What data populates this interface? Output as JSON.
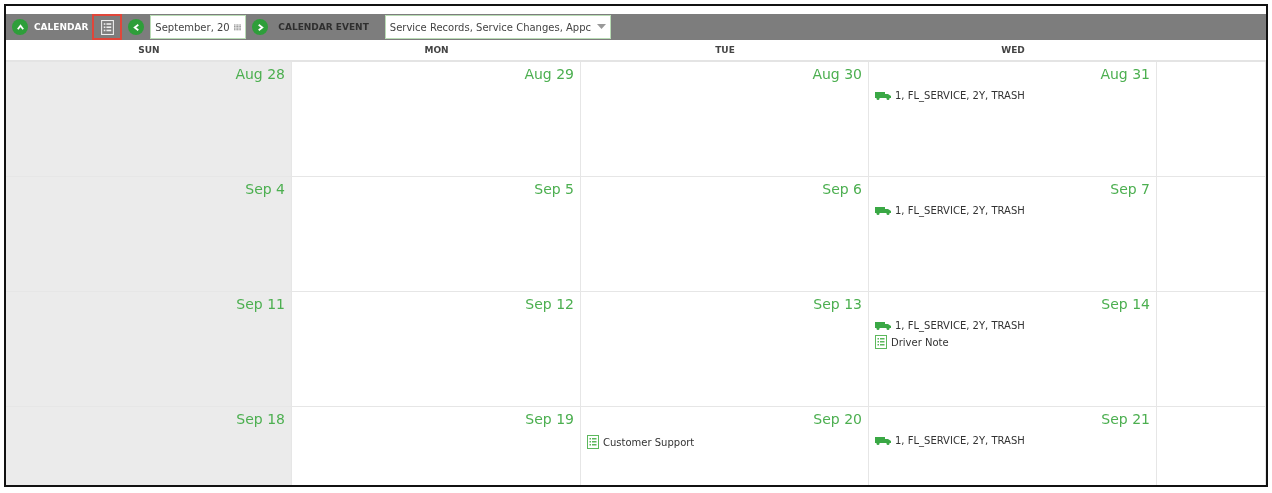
{
  "toolbar": {
    "title": "CALENDAR",
    "list_view_button": {
      "highlighted": true
    },
    "date_field": {
      "value": "September, 20"
    },
    "section_label": "CALENDAR EVENT",
    "filter_select": {
      "value": "Service Records, Service Changes, Appc"
    }
  },
  "columns": [
    {
      "label": "SUN",
      "shaded": true
    },
    {
      "label": "MON",
      "shaded": false
    },
    {
      "label": "TUE",
      "shaded": false
    },
    {
      "label": "WED",
      "shaded": false
    }
  ],
  "weeks": [
    {
      "days": [
        {
          "date": "Aug 28"
        },
        {
          "date": "Aug 29"
        },
        {
          "date": "Aug 30"
        },
        {
          "date": "Aug 31",
          "events": [
            {
              "kind": "service",
              "text": "1, FL_SERVICE, 2Y, TRASH"
            }
          ]
        }
      ]
    },
    {
      "days": [
        {
          "date": "Sep 4"
        },
        {
          "date": "Sep 5"
        },
        {
          "date": "Sep 6"
        },
        {
          "date": "Sep 7",
          "events": [
            {
              "kind": "service",
              "text": "1, FL_SERVICE, 2Y, TRASH"
            }
          ]
        }
      ]
    },
    {
      "days": [
        {
          "date": "Sep 11"
        },
        {
          "date": "Sep 12"
        },
        {
          "date": "Sep 13"
        },
        {
          "date": "Sep 14",
          "events": [
            {
              "kind": "service",
              "text": "1, FL_SERVICE, 2Y, TRASH"
            },
            {
              "kind": "note",
              "text": "Driver Note"
            }
          ]
        }
      ]
    },
    {
      "days": [
        {
          "date": "Sep 18"
        },
        {
          "date": "Sep 19"
        },
        {
          "date": "Sep 20",
          "events": [
            {
              "kind": "note",
              "text": "Customer Support"
            }
          ]
        },
        {
          "date": "Sep 21",
          "events": [
            {
              "kind": "service",
              "text": "1, FL_SERVICE, 2Y, TRASH"
            }
          ]
        }
      ]
    }
  ]
}
